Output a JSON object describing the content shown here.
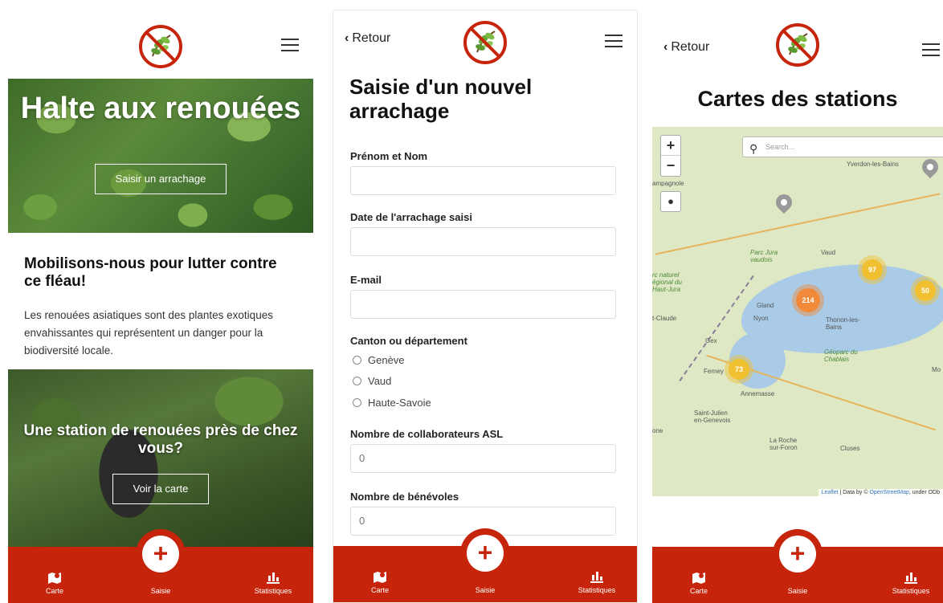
{
  "app": {
    "brand_color": "#c6250b",
    "nav": {
      "map_label": "Carte",
      "entry_label": "Saisie",
      "stats_label": "Statistiques",
      "plus_glyph": "+"
    },
    "back_label": "Retour",
    "logo_icon": "no-knotweed-logo"
  },
  "home": {
    "hero_title": "Halte aux renouées",
    "hero_button": "Saisir un arrachage",
    "heading": "Mobilisons-nous pour lutter contre ce fléau!",
    "paragraph": "Les renouées asiatiques sont des plantes exotiques envahissantes qui représentent un danger pour la biodiversité locale.",
    "station_title": "Une station de renouées près de chez vous?",
    "station_button": "Voir la carte"
  },
  "form": {
    "title": "Saisie d'un nouvel arrachage",
    "name_label": "Prénom et Nom",
    "name_value": "",
    "date_label": "Date de l'arrachage saisi",
    "date_value": "",
    "email_label": "E-mail",
    "email_value": "",
    "canton_label": "Canton ou département",
    "canton_options": [
      "Genève",
      "Vaud",
      "Haute-Savoie"
    ],
    "asl_label": "Nombre de collaborateurs ASL",
    "asl_value": "0",
    "volunteers_label": "Nombre de bénévoles",
    "volunteers_value": "0"
  },
  "map": {
    "title": "Cartes des stations",
    "search_placeholder": "Search...",
    "zoom_in": "+",
    "zoom_out": "−",
    "clusters": [
      {
        "count": "97",
        "color": "#f0c030"
      },
      {
        "count": "214",
        "color": "#f08a3a"
      },
      {
        "count": "50",
        "color": "#f0c030"
      },
      {
        "count": "73",
        "color": "#f0c030"
      }
    ],
    "places": {
      "yverdon": "Yverdon-les-Bains",
      "parc_jura": "Parc Jura vaudois",
      "vaud": "Vaud",
      "parc_naturel": "rc naturel égional du Haut-Jura",
      "campagnole": "ampagnole",
      "claude": "t-Claude",
      "gland": "Gland",
      "nyon": "Nyon",
      "thonon": "Thonon-les-Bains",
      "geoparc": "Géoparc du Chablais",
      "gex": "Gex",
      "ferney": "Ferney",
      "annemasse": "Annemasse",
      "saint_julien": "Saint-Julien en-Genevois",
      "la_roche": "La Roche sur-Foron",
      "cluses": "Cluses",
      "mo": "Mo",
      "one": "one"
    },
    "attribution": {
      "leaflet": "Leaflet",
      "middle": " | Data by © ",
      "osm": "OpenStreetMap",
      "end": ", under ODb"
    }
  }
}
